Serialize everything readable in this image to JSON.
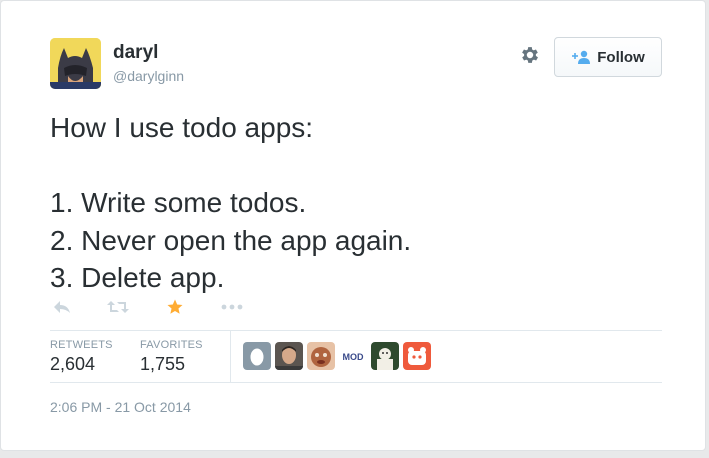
{
  "user": {
    "name": "daryl",
    "handle": "@darylginn"
  },
  "follow_button": {
    "label": "Follow"
  },
  "tweet": {
    "text": "How I use todo apps:\n\n1. Write some todos.\n2. Never open the app again.\n3. Delete app."
  },
  "actions": [
    "reply-icon",
    "retweet-icon",
    "favorite-icon",
    "more-icon"
  ],
  "stats": {
    "retweets_label": "RETWEETS",
    "retweets_value": "2,604",
    "favorites_label": "FAVORITES",
    "favorites_value": "1,755"
  },
  "favoriters": [
    {
      "icon": "egg-avatar"
    },
    {
      "icon": "user-avatar"
    },
    {
      "icon": "user-avatar"
    },
    {
      "icon": "mod-logo-avatar",
      "text": "MOD"
    },
    {
      "icon": "user-avatar"
    },
    {
      "icon": "app-logo-avatar"
    }
  ],
  "timestamp": "2:06 PM - 21 Oct 2014",
  "colors": {
    "favorite_star": "#ffac33",
    "muted": "#8899a6",
    "follow_icon": "#55acee"
  }
}
